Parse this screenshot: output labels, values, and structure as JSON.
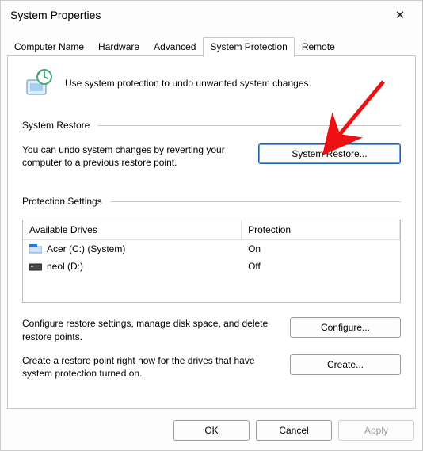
{
  "window": {
    "title": "System Properties"
  },
  "tabs": {
    "items": [
      {
        "label": "Computer Name"
      },
      {
        "label": "Hardware"
      },
      {
        "label": "Advanced"
      },
      {
        "label": "System Protection"
      },
      {
        "label": "Remote"
      }
    ],
    "active_index": 3
  },
  "intro": {
    "text": "Use system protection to undo unwanted system changes."
  },
  "restore_section": {
    "heading": "System Restore",
    "description": "You can undo system changes by reverting your computer to a previous restore point.",
    "button": "System Restore..."
  },
  "protection_section": {
    "heading": "Protection Settings",
    "columns": {
      "drive": "Available Drives",
      "protection": "Protection"
    },
    "rows": [
      {
        "icon": "drive-system-icon",
        "name": "Acer (C:) (System)",
        "protection": "On"
      },
      {
        "icon": "drive-icon",
        "name": "neol (D:)",
        "protection": "Off"
      }
    ],
    "configure_text": "Configure restore settings, manage disk space, and delete restore points.",
    "configure_button": "Configure...",
    "create_text": "Create a restore point right now for the drives that have system protection turned on.",
    "create_button": "Create..."
  },
  "buttons": {
    "ok": "OK",
    "cancel": "Cancel",
    "apply": "Apply"
  }
}
